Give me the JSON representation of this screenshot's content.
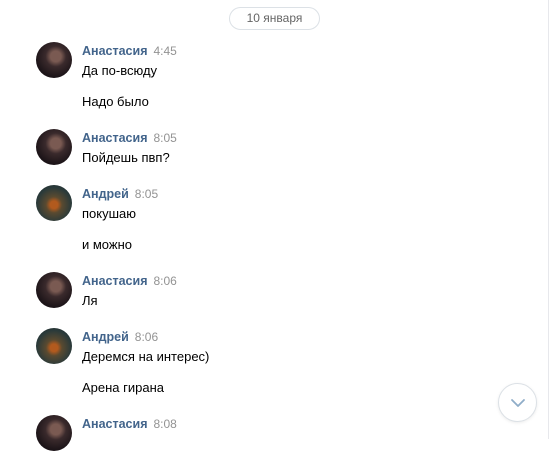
{
  "date_label": "10 января",
  "messages": [
    {
      "author": "Анастасия",
      "time": "4:45",
      "avatar": "anastasia-avatar",
      "lines": [
        "Да по-всюду",
        "Надо было"
      ]
    },
    {
      "author": "Анастасия",
      "time": "8:05",
      "avatar": "anastasia-avatar",
      "lines": [
        "Пойдешь пвп?"
      ]
    },
    {
      "author": "Андрей",
      "time": "8:05",
      "avatar": "andrey-avatar",
      "lines": [
        "покушаю",
        "и можно"
      ]
    },
    {
      "author": "Анастасия",
      "time": "8:06",
      "avatar": "anastasia-avatar",
      "lines": [
        "Ля"
      ]
    },
    {
      "author": "Андрей",
      "time": "8:06",
      "avatar": "andrey-avatar",
      "lines": [
        "Деремся на интерес)",
        "Арена гирана"
      ]
    },
    {
      "author": "Анастасия",
      "time": "8:08",
      "avatar": "anastasia-avatar",
      "lines": []
    }
  ],
  "scroll_button_icon": "chevron-down-icon",
  "colors": {
    "author": "#42648b",
    "time": "#939393",
    "border": "#dce1e6"
  }
}
